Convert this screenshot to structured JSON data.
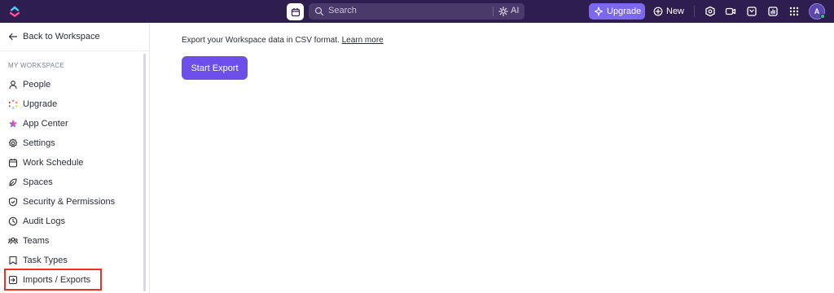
{
  "topbar": {
    "search_placeholder": "Search",
    "ai_label": "AI",
    "upgrade_label": "Upgrade",
    "new_label": "New",
    "avatar_initial": "A",
    "colors": {
      "bar": "#2e1d4f",
      "upgrade": "#7b68ee"
    }
  },
  "sidebar": {
    "back_label": "Back to Workspace",
    "section_title": "MY WORKSPACE",
    "items": [
      {
        "label": "People",
        "icon": "person-icon"
      },
      {
        "label": "Upgrade",
        "icon": "upgrade-sparkle-icon"
      },
      {
        "label": "App Center",
        "icon": "app-center-icon"
      },
      {
        "label": "Settings",
        "icon": "gear-icon"
      },
      {
        "label": "Work Schedule",
        "icon": "calendar-icon"
      },
      {
        "label": "Spaces",
        "icon": "spaces-icon"
      },
      {
        "label": "Security & Permissions",
        "icon": "shield-icon"
      },
      {
        "label": "Audit Logs",
        "icon": "audit-icon"
      },
      {
        "label": "Teams",
        "icon": "teams-icon"
      },
      {
        "label": "Task Types",
        "icon": "task-types-icon"
      },
      {
        "label": "Imports / Exports",
        "icon": "import-export-icon"
      }
    ]
  },
  "main": {
    "description": "Export your Workspace data in CSV format.",
    "learn_more": "Learn more",
    "export_button": "Start Export",
    "accent": "#6b4fe8"
  }
}
